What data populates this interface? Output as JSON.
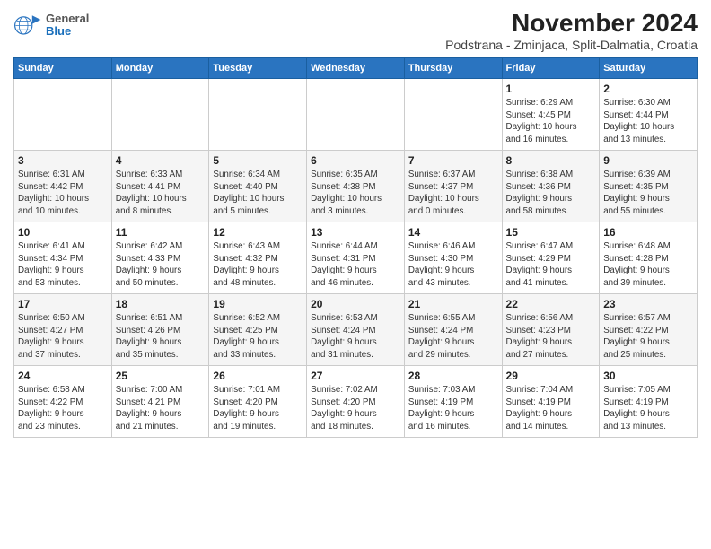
{
  "header": {
    "logo_general": "General",
    "logo_blue": "Blue",
    "title": "November 2024",
    "subtitle": "Podstrana - Zminjaca, Split-Dalmatia, Croatia"
  },
  "weekdays": [
    "Sunday",
    "Monday",
    "Tuesday",
    "Wednesday",
    "Thursday",
    "Friday",
    "Saturday"
  ],
  "weeks": [
    [
      {
        "day": "",
        "info": ""
      },
      {
        "day": "",
        "info": ""
      },
      {
        "day": "",
        "info": ""
      },
      {
        "day": "",
        "info": ""
      },
      {
        "day": "",
        "info": ""
      },
      {
        "day": "1",
        "info": "Sunrise: 6:29 AM\nSunset: 4:45 PM\nDaylight: 10 hours\nand 16 minutes."
      },
      {
        "day": "2",
        "info": "Sunrise: 6:30 AM\nSunset: 4:44 PM\nDaylight: 10 hours\nand 13 minutes."
      }
    ],
    [
      {
        "day": "3",
        "info": "Sunrise: 6:31 AM\nSunset: 4:42 PM\nDaylight: 10 hours\nand 10 minutes."
      },
      {
        "day": "4",
        "info": "Sunrise: 6:33 AM\nSunset: 4:41 PM\nDaylight: 10 hours\nand 8 minutes."
      },
      {
        "day": "5",
        "info": "Sunrise: 6:34 AM\nSunset: 4:40 PM\nDaylight: 10 hours\nand 5 minutes."
      },
      {
        "day": "6",
        "info": "Sunrise: 6:35 AM\nSunset: 4:38 PM\nDaylight: 10 hours\nand 3 minutes."
      },
      {
        "day": "7",
        "info": "Sunrise: 6:37 AM\nSunset: 4:37 PM\nDaylight: 10 hours\nand 0 minutes."
      },
      {
        "day": "8",
        "info": "Sunrise: 6:38 AM\nSunset: 4:36 PM\nDaylight: 9 hours\nand 58 minutes."
      },
      {
        "day": "9",
        "info": "Sunrise: 6:39 AM\nSunset: 4:35 PM\nDaylight: 9 hours\nand 55 minutes."
      }
    ],
    [
      {
        "day": "10",
        "info": "Sunrise: 6:41 AM\nSunset: 4:34 PM\nDaylight: 9 hours\nand 53 minutes."
      },
      {
        "day": "11",
        "info": "Sunrise: 6:42 AM\nSunset: 4:33 PM\nDaylight: 9 hours\nand 50 minutes."
      },
      {
        "day": "12",
        "info": "Sunrise: 6:43 AM\nSunset: 4:32 PM\nDaylight: 9 hours\nand 48 minutes."
      },
      {
        "day": "13",
        "info": "Sunrise: 6:44 AM\nSunset: 4:31 PM\nDaylight: 9 hours\nand 46 minutes."
      },
      {
        "day": "14",
        "info": "Sunrise: 6:46 AM\nSunset: 4:30 PM\nDaylight: 9 hours\nand 43 minutes."
      },
      {
        "day": "15",
        "info": "Sunrise: 6:47 AM\nSunset: 4:29 PM\nDaylight: 9 hours\nand 41 minutes."
      },
      {
        "day": "16",
        "info": "Sunrise: 6:48 AM\nSunset: 4:28 PM\nDaylight: 9 hours\nand 39 minutes."
      }
    ],
    [
      {
        "day": "17",
        "info": "Sunrise: 6:50 AM\nSunset: 4:27 PM\nDaylight: 9 hours\nand 37 minutes."
      },
      {
        "day": "18",
        "info": "Sunrise: 6:51 AM\nSunset: 4:26 PM\nDaylight: 9 hours\nand 35 minutes."
      },
      {
        "day": "19",
        "info": "Sunrise: 6:52 AM\nSunset: 4:25 PM\nDaylight: 9 hours\nand 33 minutes."
      },
      {
        "day": "20",
        "info": "Sunrise: 6:53 AM\nSunset: 4:24 PM\nDaylight: 9 hours\nand 31 minutes."
      },
      {
        "day": "21",
        "info": "Sunrise: 6:55 AM\nSunset: 4:24 PM\nDaylight: 9 hours\nand 29 minutes."
      },
      {
        "day": "22",
        "info": "Sunrise: 6:56 AM\nSunset: 4:23 PM\nDaylight: 9 hours\nand 27 minutes."
      },
      {
        "day": "23",
        "info": "Sunrise: 6:57 AM\nSunset: 4:22 PM\nDaylight: 9 hours\nand 25 minutes."
      }
    ],
    [
      {
        "day": "24",
        "info": "Sunrise: 6:58 AM\nSunset: 4:22 PM\nDaylight: 9 hours\nand 23 minutes."
      },
      {
        "day": "25",
        "info": "Sunrise: 7:00 AM\nSunset: 4:21 PM\nDaylight: 9 hours\nand 21 minutes."
      },
      {
        "day": "26",
        "info": "Sunrise: 7:01 AM\nSunset: 4:20 PM\nDaylight: 9 hours\nand 19 minutes."
      },
      {
        "day": "27",
        "info": "Sunrise: 7:02 AM\nSunset: 4:20 PM\nDaylight: 9 hours\nand 18 minutes."
      },
      {
        "day": "28",
        "info": "Sunrise: 7:03 AM\nSunset: 4:19 PM\nDaylight: 9 hours\nand 16 minutes."
      },
      {
        "day": "29",
        "info": "Sunrise: 7:04 AM\nSunset: 4:19 PM\nDaylight: 9 hours\nand 14 minutes."
      },
      {
        "day": "30",
        "info": "Sunrise: 7:05 AM\nSunset: 4:19 PM\nDaylight: 9 hours\nand 13 minutes."
      }
    ]
  ]
}
